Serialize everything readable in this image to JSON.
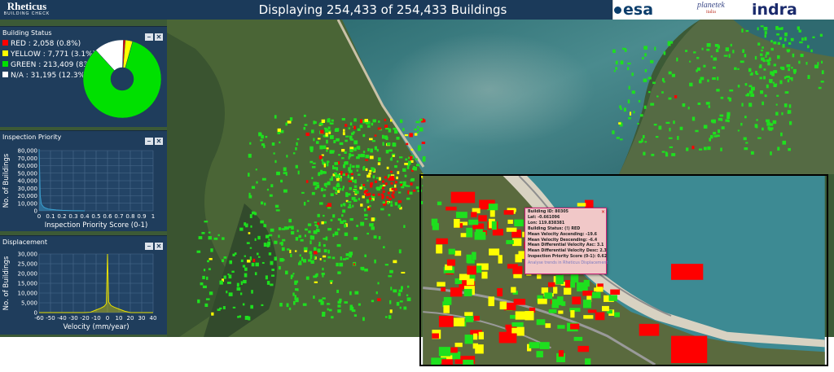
{
  "header": {
    "title": "Displaying 254,433 of 254,433 Buildings",
    "logo_text": "Rheticus",
    "logo_sub": "BUILDING CHECK",
    "partners": {
      "esa": "esa",
      "planetek": "planetek",
      "planetek_sub": "italia",
      "indra": "indra"
    }
  },
  "colors": {
    "red": "#ff0000",
    "yellow": "#ffff00",
    "green": "#00e000",
    "na": "#ffffff",
    "panel": "#1f3d5c",
    "header": "#1b3a5a"
  },
  "panels": {
    "building_status": {
      "title": "Building Status",
      "legend": [
        {
          "label": "RED : 2,058 (0.8%)",
          "color": "#ff0000"
        },
        {
          "label": "YELLOW : 7,771 (3.1%)",
          "color": "#ffff00"
        },
        {
          "label": "GREEN : 213,409 (83.9%)",
          "color": "#00e000"
        },
        {
          "label": "N/A : 31,195 (12.3%)",
          "color": "#ffffff"
        }
      ]
    },
    "inspection_priority": {
      "title": "Inspection Priority"
    },
    "displacement": {
      "title": "Displacement"
    }
  },
  "chart_data": [
    {
      "type": "pie",
      "title": "",
      "categories": [
        "RED",
        "YELLOW",
        "GREEN",
        "N/A"
      ],
      "values": [
        2058,
        7771,
        213409,
        31195
      ],
      "percent": [
        0.8,
        3.1,
        83.9,
        12.3
      ],
      "colors": [
        "#ff0000",
        "#ffff00",
        "#00e000",
        "#ffffff"
      ],
      "donut": true
    },
    {
      "type": "area",
      "title": "",
      "xlabel": "Inspection Priority Score (0-1)",
      "ylabel": "No. of Buildings",
      "x": [
        0,
        0.01,
        0.02,
        0.04,
        0.06,
        0.08,
        0.1,
        0.15,
        0.2,
        0.25,
        0.3,
        0.35,
        0.4
      ],
      "y": [
        82000,
        20000,
        9000,
        5000,
        3500,
        2500,
        2000,
        1200,
        700,
        400,
        200,
        80,
        0
      ],
      "xlim": [
        0,
        1
      ],
      "ylim": [
        0,
        80000
      ],
      "xticks": [
        "0",
        "0.1",
        "0.2",
        "0.3",
        "0.4",
        "0.5",
        "0.6",
        "0.7",
        "0.8",
        "0.9",
        "1"
      ],
      "yticks": [
        "0",
        "10,000",
        "20,000",
        "30,000",
        "40,000",
        "50,000",
        "60,000",
        "70,000",
        "80,000"
      ],
      "grid": true
    },
    {
      "type": "area",
      "title": "",
      "xlabel": "Velocity (mm/year)",
      "ylabel": "No. of Buildings",
      "x": [
        -60,
        -20,
        -15,
        -10,
        -6,
        -3,
        -1,
        0,
        1,
        3,
        6,
        10,
        15,
        20,
        40
      ],
      "y": [
        0,
        0,
        200,
        1500,
        2500,
        3500,
        5000,
        33000,
        6000,
        4000,
        3000,
        2000,
        800,
        0,
        0
      ],
      "xlim": [
        -60,
        40
      ],
      "ylim": [
        0,
        33000
      ],
      "xticks": [
        "-60",
        "-50",
        "-40",
        "-30",
        "-20",
        "-10",
        "0",
        "10",
        "20",
        "30",
        "40"
      ],
      "yticks": [
        "0",
        "5,000",
        "10,000",
        "15,000",
        "20,000",
        "25,000",
        "30,000"
      ],
      "grid": true
    }
  ],
  "popup": {
    "lines": [
      "Building ID: 80305",
      "Lat: -0.661096",
      "Lon: 119.838381",
      "Building Status: (!) RED",
      "Mean Velocity Ascending: -19.6",
      "Mean Velocity Descending: -6.4",
      "Mean Differential Velocity Asc: 3.1",
      "Mean Differential Velocity Desc: 2.3",
      "Inspection Priority Score (0-1): 0.62"
    ],
    "link": "Analyse trends in Rheticus Displacement",
    "close": "×"
  }
}
